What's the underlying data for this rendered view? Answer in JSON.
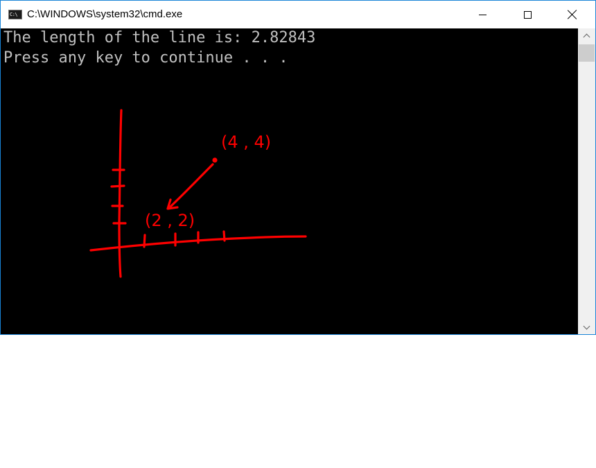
{
  "window": {
    "title": "C:\\WINDOWS\\system32\\cmd.exe",
    "icon": "cmd-app-icon",
    "icon_text": "C:\\",
    "buttons": {
      "minimize": "minimize-icon",
      "maximize": "maximize-icon",
      "close": "close-icon"
    }
  },
  "console": {
    "lines": [
      "The length of the line is: 2.82843",
      "Press any key to continue . . ."
    ],
    "background": "#000000",
    "text_color": "#c0c0c0"
  },
  "annotation": {
    "color": "#ff0000",
    "point_a": "(2 , 2)",
    "point_b": "(4 , 4)"
  }
}
